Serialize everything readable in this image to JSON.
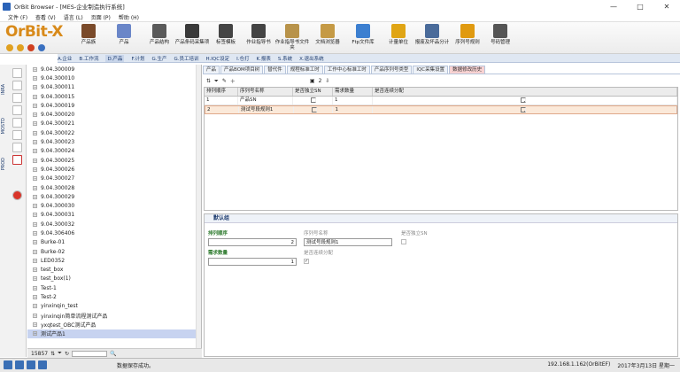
{
  "window": {
    "title": "OrBit Browser - [MES-企业制造执行系统]",
    "controls": [
      "—",
      "□",
      "✕"
    ]
  },
  "menu": [
    "文件 (F)",
    "查看 (V)",
    "语言 (L)",
    "页面 (P)",
    "帮助 (H)"
  ],
  "logo": "OrBit-X",
  "toolbar": [
    {
      "label": "产品族",
      "color": "#7a4a2a"
    },
    {
      "label": "产品",
      "color": "#6a86c8"
    },
    {
      "label": "产品结构",
      "color": "#5a5a5a"
    },
    {
      "label": "产品条码采集项",
      "color": "#3a3a3a"
    },
    {
      "label": "标签模板",
      "color": "#444"
    },
    {
      "label": "作业指导书",
      "color": "#444"
    },
    {
      "label": "作业指导书文件夹",
      "color": "#b8934a"
    },
    {
      "label": "文档浏览器",
      "color": "#c59a45"
    },
    {
      "label": "Ftp文件库",
      "color": "#3c7fd0"
    },
    {
      "label": "计量单位",
      "color": "#e0a515"
    },
    {
      "label": "报废及坏品分计",
      "color": "#4a6b9a"
    },
    {
      "label": "序列号规则",
      "color": "#e09a10"
    },
    {
      "label": "号码管理",
      "color": "#555"
    }
  ],
  "navtabs": [
    "A.企业",
    "B.工作流",
    "D.产品",
    "F.计划",
    "G.生产",
    "G.员工培训",
    "H.IQC设定",
    "I.仓打",
    "K.报表",
    "S.系统",
    "X.退出系统"
  ],
  "navtabs_active": "D.产品",
  "left_vertical_labels": [
    "INRA",
    "MOSTD",
    "PROD"
  ],
  "tree": [
    "9.04.300009",
    "9.04.300010",
    "9.04.300011",
    "9.04.300015",
    "9.04.300019",
    "9.04.300020",
    "9.04.300021",
    "9.04.300022",
    "9.04.300023",
    "9.04.300024",
    "9.04.300025",
    "9.04.300026",
    "9.04.300027",
    "9.04.300028",
    "9.04.300029",
    "9.04.300030",
    "9.04.300031",
    "9.04.300032",
    "9.04.306406",
    "Burke-01",
    "Burke-02",
    "LED0352",
    "test_box",
    "test_box(1)",
    "Test-1",
    "Test-2",
    "yinxinqin_test",
    "yinxinqin简单流程测试产品",
    "yxqtest_OBC测试产品",
    "测试产品1"
  ],
  "tree_selected": "测试产品1",
  "tree_bottom": {
    "count": "15857"
  },
  "subtabs": [
    "产品",
    "产品BOM项目树",
    "替代件",
    "规程标准工时",
    "工作中心标准工时",
    "产品序列号类型",
    "IQC采集设置",
    "数据修改历史"
  ],
  "subtab_active": "数据修改历史",
  "grid": {
    "page": "2",
    "headers": [
      "排列顺序",
      "序列号名称",
      "是否独立SN",
      "需求数量",
      "是否连续分配"
    ],
    "rows": [
      {
        "seq": "1",
        "name": "产品SN",
        "independent": false,
        "qty": "1",
        "continuous": true
      },
      {
        "seq": "2",
        "name": "测试号段规则1",
        "independent": false,
        "qty": "1",
        "continuous": true
      }
    ]
  },
  "details": {
    "title": "默认组",
    "seq_label": "排列顺序",
    "seq_value": "2",
    "name_label": "序列号名称",
    "name_value": "测试号段规则1",
    "indep_label": "是否独立SN",
    "qty_label": "需求数量",
    "qty_value": "1",
    "cont_label": "是否连续分配"
  },
  "status": {
    "message": "数据保存成功。",
    "ip": "192.168.1.162(OrBitEF)",
    "date": "2017年3月13日 星期一"
  }
}
